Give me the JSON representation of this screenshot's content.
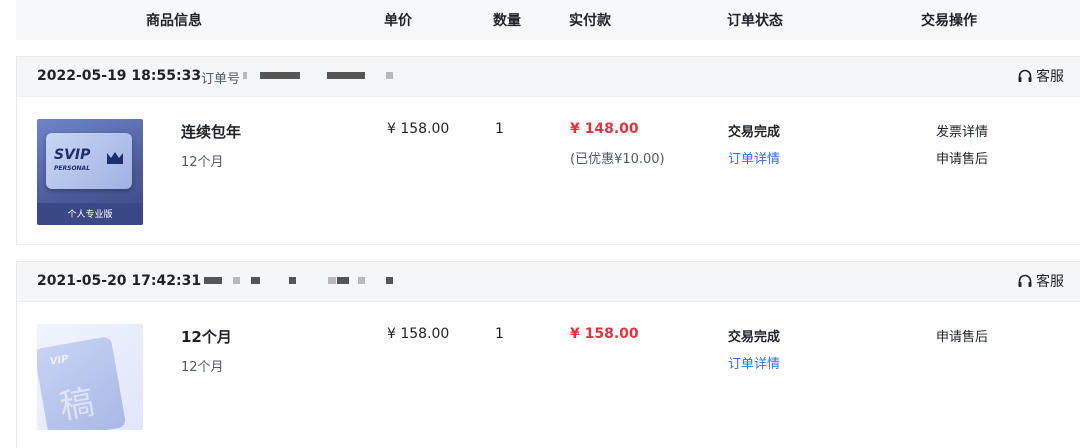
{
  "columns": {
    "product": "商品信息",
    "unit_price": "单价",
    "quantity": "数量",
    "paid": "实付款",
    "status": "订单状态",
    "actions": "交易操作"
  },
  "orders": [
    {
      "time": "2022-05-19 18:55:33",
      "order_no_label": "订单号",
      "service_label": "客服",
      "product_name": "连续包年",
      "product_sub": "12个月",
      "thumb_title": "SVIP",
      "thumb_sub": "PERSONAL",
      "thumb_caption": "个人专业版",
      "unit_price": "¥ 158.00",
      "quantity": "1",
      "paid": "¥ 148.00",
      "discount": "(已优惠¥10.00)",
      "status": "交易完成",
      "detail_link": "订单详情",
      "actions": [
        "发票详情",
        "申请售后"
      ]
    },
    {
      "time": "2021-05-20 17:42:31",
      "service_label": "客服",
      "product_name": "12个月",
      "product_sub": "12个月",
      "thumb_title": "VIP",
      "unit_price": "¥ 158.00",
      "quantity": "1",
      "paid": "¥ 158.00",
      "status": "交易完成",
      "detail_link": "订单详情",
      "actions": [
        "申请售后"
      ]
    }
  ],
  "colors": {
    "paid_red": "#e2333f",
    "link_blue": "#2f6bff"
  }
}
